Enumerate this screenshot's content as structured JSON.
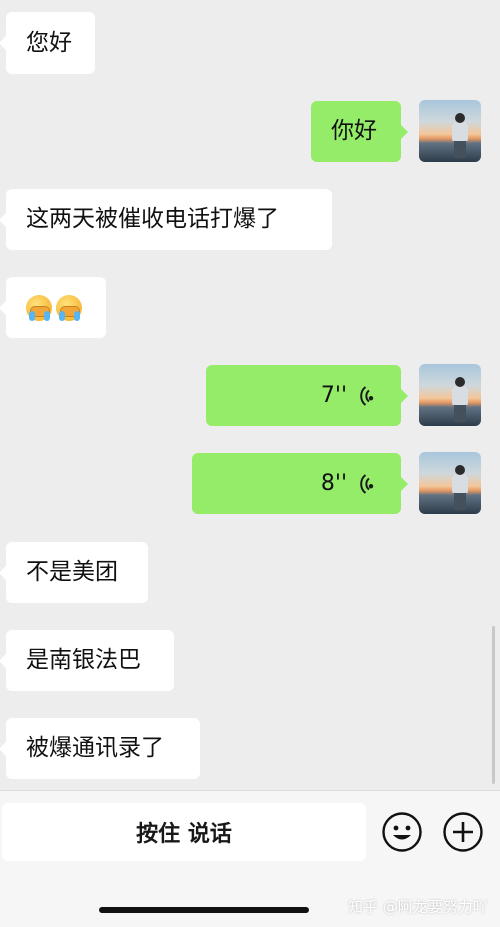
{
  "messages": [
    {
      "side": "left",
      "text": "您好"
    },
    {
      "side": "right",
      "text": "你好"
    },
    {
      "side": "left",
      "text": "这两天被催收电话打爆了"
    },
    {
      "side": "left",
      "emoji": [
        "face-palm-crying-emoji",
        "face-palm-crying-emoji"
      ]
    },
    {
      "side": "right",
      "type": "voice",
      "duration": "7''"
    },
    {
      "side": "right",
      "type": "voice",
      "duration": "8''"
    },
    {
      "side": "left",
      "text": "不是美团"
    },
    {
      "side": "left",
      "text": "是南银法巴"
    },
    {
      "side": "left",
      "text": "被爆通讯录了"
    }
  ],
  "input_bar": {
    "hold_to_talk_label": "按住 说话",
    "emoji_icon": "smiley-icon",
    "more_icon": "plus-circle-icon"
  },
  "watermark": "知乎 @阿龙要努力吖",
  "colors": {
    "background": "#ededed",
    "outgoing_bubble": "#95ec69",
    "incoming_bubble": "#ffffff"
  }
}
